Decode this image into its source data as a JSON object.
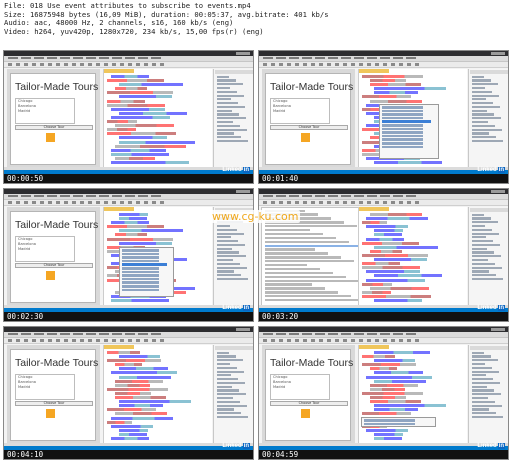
{
  "info": {
    "file": "File: 018 Use event attributes to subscribe to events.mp4",
    "size": "Size: 16875948 bytes (16,09 MiB), duration: 00:05:37, avg.bitrate: 401 kb/s",
    "audio": "Audio: aac, 48000 Hz, 2 channels, s16, 160 kb/s (eng)",
    "video": "Video: h264, yuv420p, 1280x720, 234 kb/s, 15,00 fps(r) (eng)"
  },
  "window_title": "Tailor-Made Tours",
  "list_items": [
    "Chicago",
    "Barcelona",
    "Madrid"
  ],
  "button_label": "Choose Tour",
  "brand": {
    "text": "Linked",
    "suffix": "in"
  },
  "watermark": "www.cg-ku.com",
  "thumbnails": [
    {
      "timestamp": "00:00:50",
      "variant": "code"
    },
    {
      "timestamp": "00:01:40",
      "variant": "popup"
    },
    {
      "timestamp": "00:02:30",
      "variant": "code-popup"
    },
    {
      "timestamp": "00:03:20",
      "variant": "list"
    },
    {
      "timestamp": "00:04:10",
      "variant": "code"
    },
    {
      "timestamp": "00:04:59",
      "variant": "code-hint"
    }
  ],
  "colors": {
    "accent_blue": "#007acc",
    "image_orange": "#f5a623",
    "ide_dark": "#2d2d30",
    "watermark_orange": "#f0a81c"
  }
}
